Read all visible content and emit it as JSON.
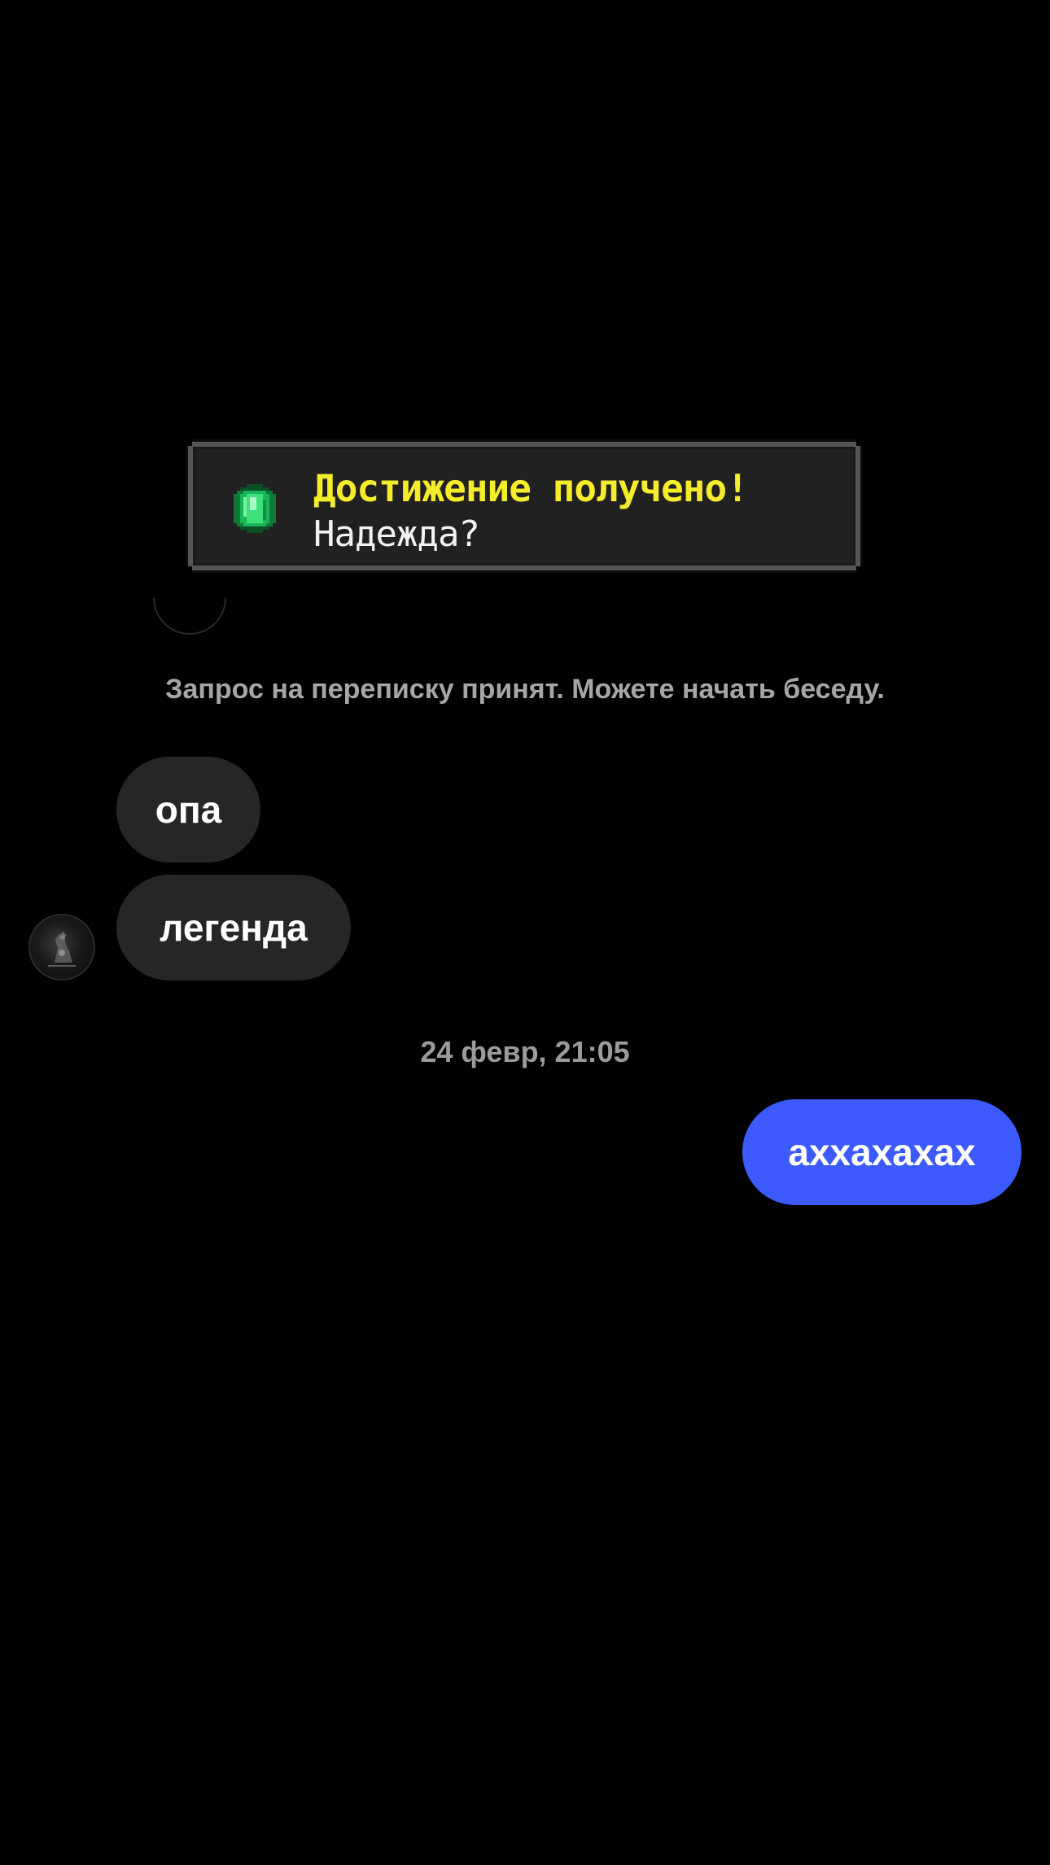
{
  "toast": {
    "title": "Достижение получено!",
    "subtitle": "Надежда?",
    "icon": "emerald-icon",
    "title_color": "#f5ec2b"
  },
  "chat": {
    "system_notice": "Запрос на переписку принят. Можете начать беседу.",
    "messages": [
      {
        "from": "contact",
        "text": "опа"
      },
      {
        "from": "contact",
        "text": "легенда"
      },
      {
        "from": "me",
        "text": "аххахахах"
      }
    ],
    "timestamp": "24 февр, 21:05",
    "outgoing_color": "#3d5afe",
    "incoming_color": "#262626"
  }
}
